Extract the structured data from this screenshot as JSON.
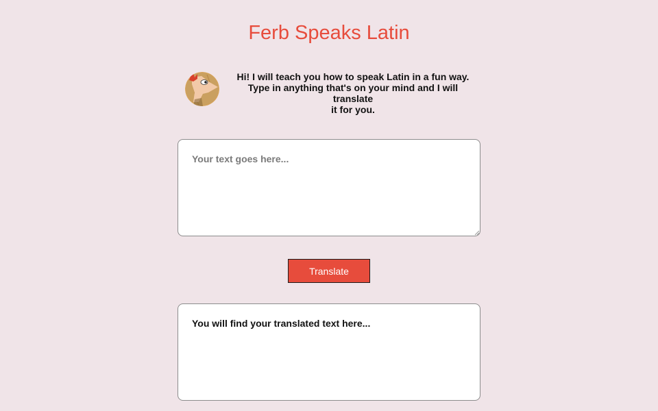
{
  "header": {
    "title": "Ferb Speaks Latin"
  },
  "intro": {
    "avatar_icon": "ferb-cartoon-avatar",
    "lines": [
      "Hi! I will teach you how to speak Latin in a fun way.",
      "Type in anything that's on your mind and I will translate",
      "it for you."
    ]
  },
  "input": {
    "value": "",
    "placeholder": "Your text goes here..."
  },
  "translate_button": {
    "label": "Translate"
  },
  "output": {
    "text": "You will find your translated text here..."
  },
  "colors": {
    "background": "#f0e4e8",
    "accent": "#e74c3c",
    "panel": "#ffffff",
    "border": "#8c8c8c"
  }
}
